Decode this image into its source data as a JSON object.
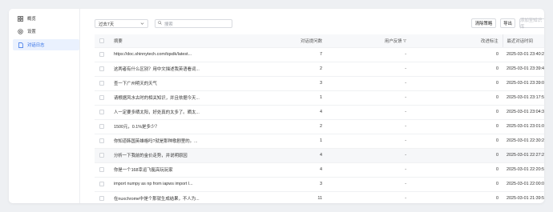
{
  "sidebar": {
    "items": [
      {
        "label": "概览",
        "icon": "grid-icon"
      },
      {
        "label": "设置",
        "icon": "gear-icon"
      },
      {
        "label": "对话日志",
        "icon": "document-icon",
        "active": true
      }
    ]
  },
  "toolbar": {
    "date_filter": "过去7天",
    "search_placeholder": "搜索",
    "clear_label": "清除策略",
    "export_label": "导出",
    "add_label": "添加至知识库"
  },
  "table": {
    "headers": [
      "摘要",
      "对话提问数",
      "用户反馈",
      "改进标注",
      "最近对话时间"
    ],
    "rows": [
      {
        "summary": "https://doc.shinnytech.com/tqsdk/latest...",
        "count": "7",
        "feedback": "-",
        "mark": "0",
        "time": "2025-03-01 23:40:26"
      },
      {
        "summary": "这两者有什么区别？用中文描述我英语看词...",
        "count": "2",
        "feedback": "-",
        "mark": "0",
        "time": "2025-03-01 23:39:47"
      },
      {
        "summary": "查一下广州明天的天气",
        "count": "3",
        "feedback": "-",
        "mark": "0",
        "time": "2025-03-01 23:39:00"
      },
      {
        "summary": "请根据风水古时的相关知识，并且依据今天...",
        "count": "1",
        "feedback": "-",
        "mark": "0",
        "time": "2025-03-01 23:17:53"
      },
      {
        "summary": "人一定要多晒太阳，好处真的太多了。晒太...",
        "count": "4",
        "feedback": "-",
        "mark": "0",
        "time": "2025-03-01 23:04:33"
      },
      {
        "summary": "1500元，0.1%是多少？",
        "count": "2",
        "feedback": "-",
        "mark": "0",
        "time": "2025-03-01 23:01:08"
      },
      {
        "summary": "你知道韩国英雄格吗?就是那种歌剧里的。...",
        "count": "1",
        "feedback": "-",
        "mark": "0",
        "time": "2025-03-01 22:30:22"
      },
      {
        "summary": "分析一下我前的金价走势，并说明原因",
        "count": "4",
        "feedback": "-",
        "mark": "0",
        "time": "2025-03-01 22:27:22",
        "highlight": true
      },
      {
        "summary": "你是一个168幸运飞艇高玩玩家",
        "count": "4",
        "feedback": "-",
        "mark": "0",
        "time": "2025-03-01 22:20:58"
      },
      {
        "summary": "import numpy as np from iapws import l...",
        "count": "3",
        "feedback": "-",
        "mark": "0",
        "time": "2025-03-01 22:00:09"
      },
      {
        "summary": "在nuxchrome中是个那就生成结果，不人为...",
        "count": "11",
        "feedback": "-",
        "mark": "0",
        "time": "2025-03-01 21:39:56"
      }
    ]
  }
}
